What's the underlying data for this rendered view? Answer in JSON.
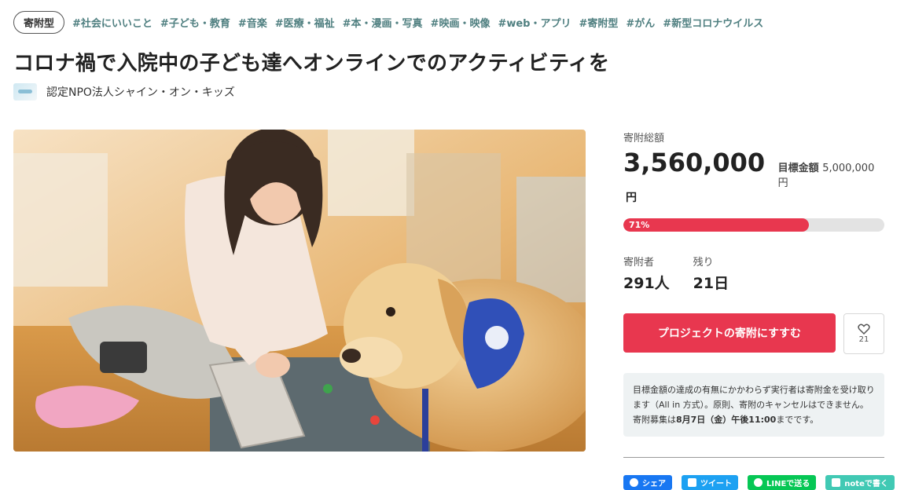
{
  "tags": {
    "type_badge": "寄附型",
    "items": [
      "#社会にいいこと",
      "#子ども・教育",
      "#音楽",
      "#医療・福祉",
      "#本・漫画・写真",
      "#映画・映像",
      "#web・アプリ",
      "#寄附型",
      "#がん",
      "#新型コロナウイルス"
    ]
  },
  "project": {
    "title": "コロナ禍で入院中の子ども達へオンラインでのアクティビティを",
    "org_name": "認定NPO法人シャイン・オン・キッズ"
  },
  "funding": {
    "total_label": "寄附総額",
    "total_amount": "3,560,000",
    "currency": "円",
    "goal_label": "目標金額",
    "goal_amount": "5,000,000円",
    "progress_text": "71%",
    "progress_value": 0.71
  },
  "stats": {
    "donors_label": "寄附者",
    "donors_value": "291人",
    "remaining_label": "残り",
    "remaining_value": "21日"
  },
  "cta": {
    "label": "プロジェクトの寄附にすすむ",
    "favorite_count": "21"
  },
  "notice": {
    "pre": "目標金額の達成の有無にかかわらず実行者は寄附金を受け取ります（All in 方式）。原則、寄附のキャンセルはできません。寄附募集は",
    "deadline": "8月7日（金）午後11:00",
    "post": "までです。"
  },
  "share": {
    "facebook": "シェア",
    "twitter": "ツイート",
    "line": "LINEで送る",
    "note": "noteで書く"
  },
  "colors": {
    "accent": "#e8374f",
    "tag": "#4f7f80",
    "facebook": "#1877f2",
    "twitter": "#1da1f2",
    "line": "#06c755",
    "note": "#41c9b4"
  }
}
